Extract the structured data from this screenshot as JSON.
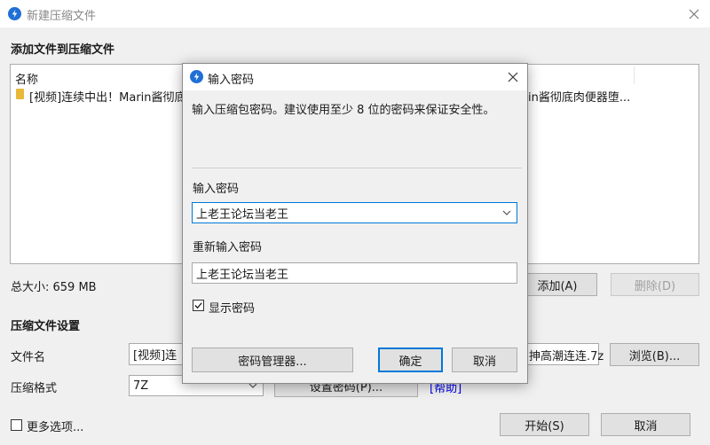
{
  "window": {
    "title": "新建压缩文件",
    "close_icon": "close-icon"
  },
  "add_section": {
    "heading": "添加文件到压缩文件",
    "column_header": "名称",
    "file_item_left": "[视频]连续中出！Marin酱彻底",
    "file_item_right": "in酱彻底肉便器堕...",
    "total_size": "总大小: 659 MB",
    "add_button": "添加(A)",
    "delete_button": "删除(D)"
  },
  "settings_section": {
    "heading": "压缩文件设置",
    "filename_label": "文件名",
    "filename_value_left": "[视频]连",
    "filename_value_right": "抻高潮连连.7z",
    "browse_button": "浏览(B)...",
    "format_label": "压缩格式",
    "format_value": "7Z",
    "set_password_button": "设置密码(P)...",
    "help_link": "[帮助]",
    "more_options_label": "更多选项...",
    "start_button": "开始(S)",
    "cancel_button": "取消"
  },
  "password_dialog": {
    "title": "输入密码",
    "description": "输入压缩包密码。建议使用至少 8 位的密码来保证安全性。",
    "password_label": "输入密码",
    "password_value": "上老王论坛当老王",
    "reenter_label": "重新输入密码",
    "reenter_value": "上老王论坛当老王",
    "show_password_label": "显示密码",
    "show_password_checked": true,
    "password_manager_button": "密码管理器...",
    "ok_button": "确定",
    "cancel_button": "取消"
  },
  "colors": {
    "accent": "#0078d7",
    "logo_blue": "#1f6fd6",
    "link": "#0000ee",
    "folder": "#e8b83a"
  }
}
